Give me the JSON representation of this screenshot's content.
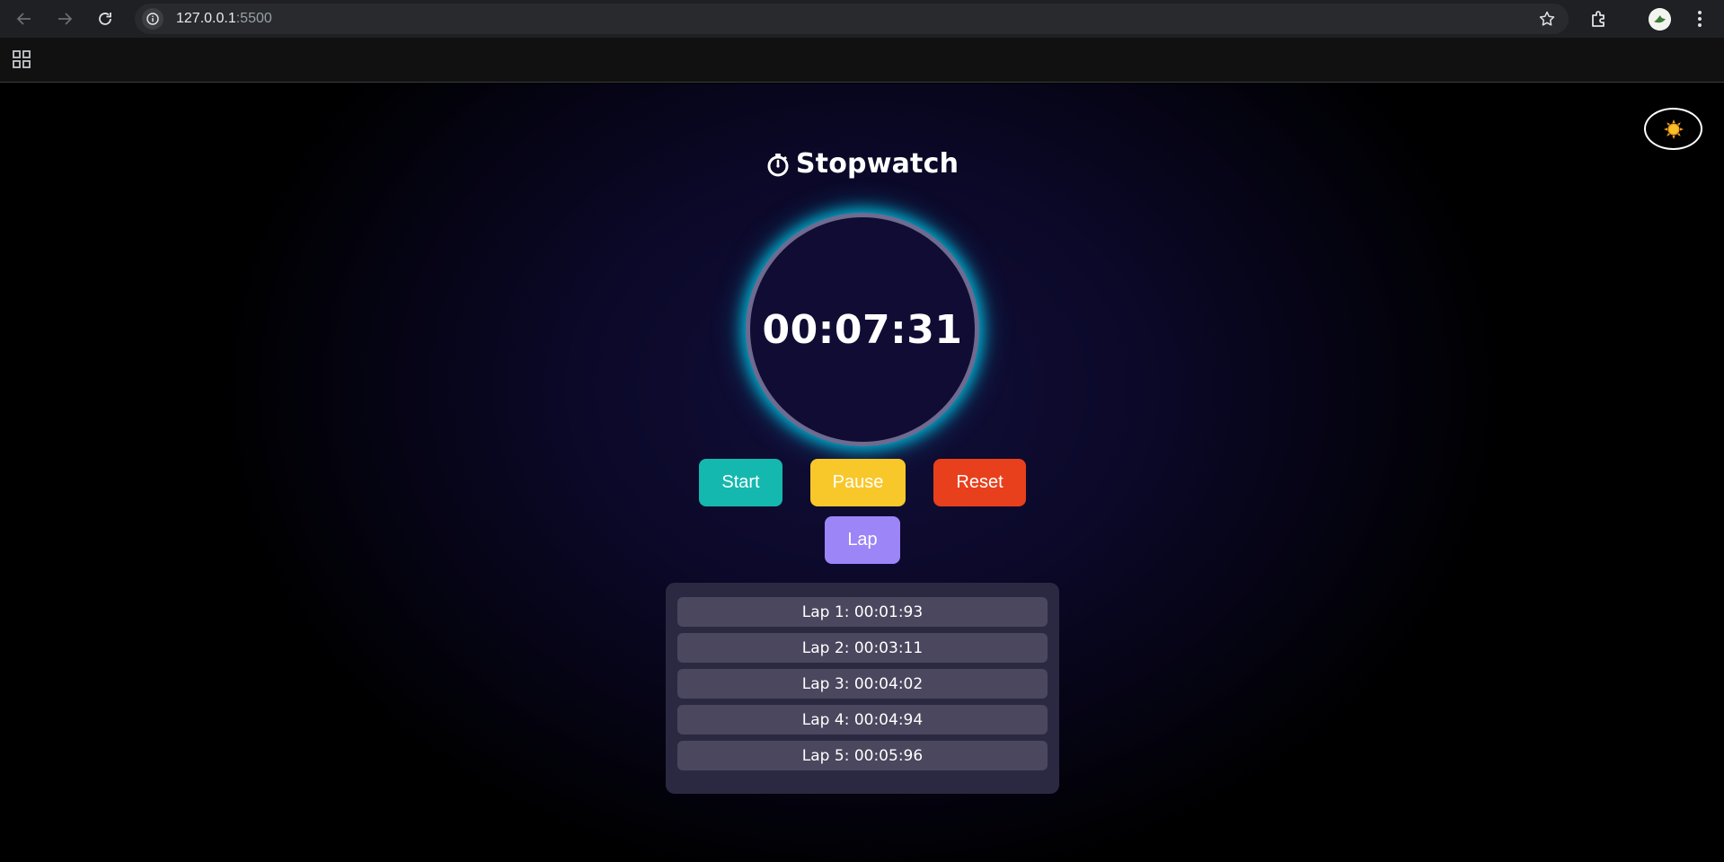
{
  "browser": {
    "url_host": "127.0.0.1",
    "url_port": ":5500"
  },
  "app": {
    "title": "Stopwatch",
    "time": "00:07:31",
    "buttons": {
      "start": "Start",
      "pause": "Pause",
      "reset": "Reset",
      "lap": "Lap"
    },
    "laps": [
      "Lap 1: 00:01:93",
      "Lap 2: 00:03:11",
      "Lap 3: 00:04:02",
      "Lap 4: 00:04:94",
      "Lap 5: 00:05:96"
    ]
  },
  "icons": {
    "theme_toggle": "sun-icon",
    "title": "stopwatch-icon"
  },
  "colors": {
    "start": "#15b8ae",
    "pause": "#f8c72a",
    "reset": "#e8401c",
    "lap": "#9c85f7",
    "dial_glow": "#00c8e6"
  }
}
